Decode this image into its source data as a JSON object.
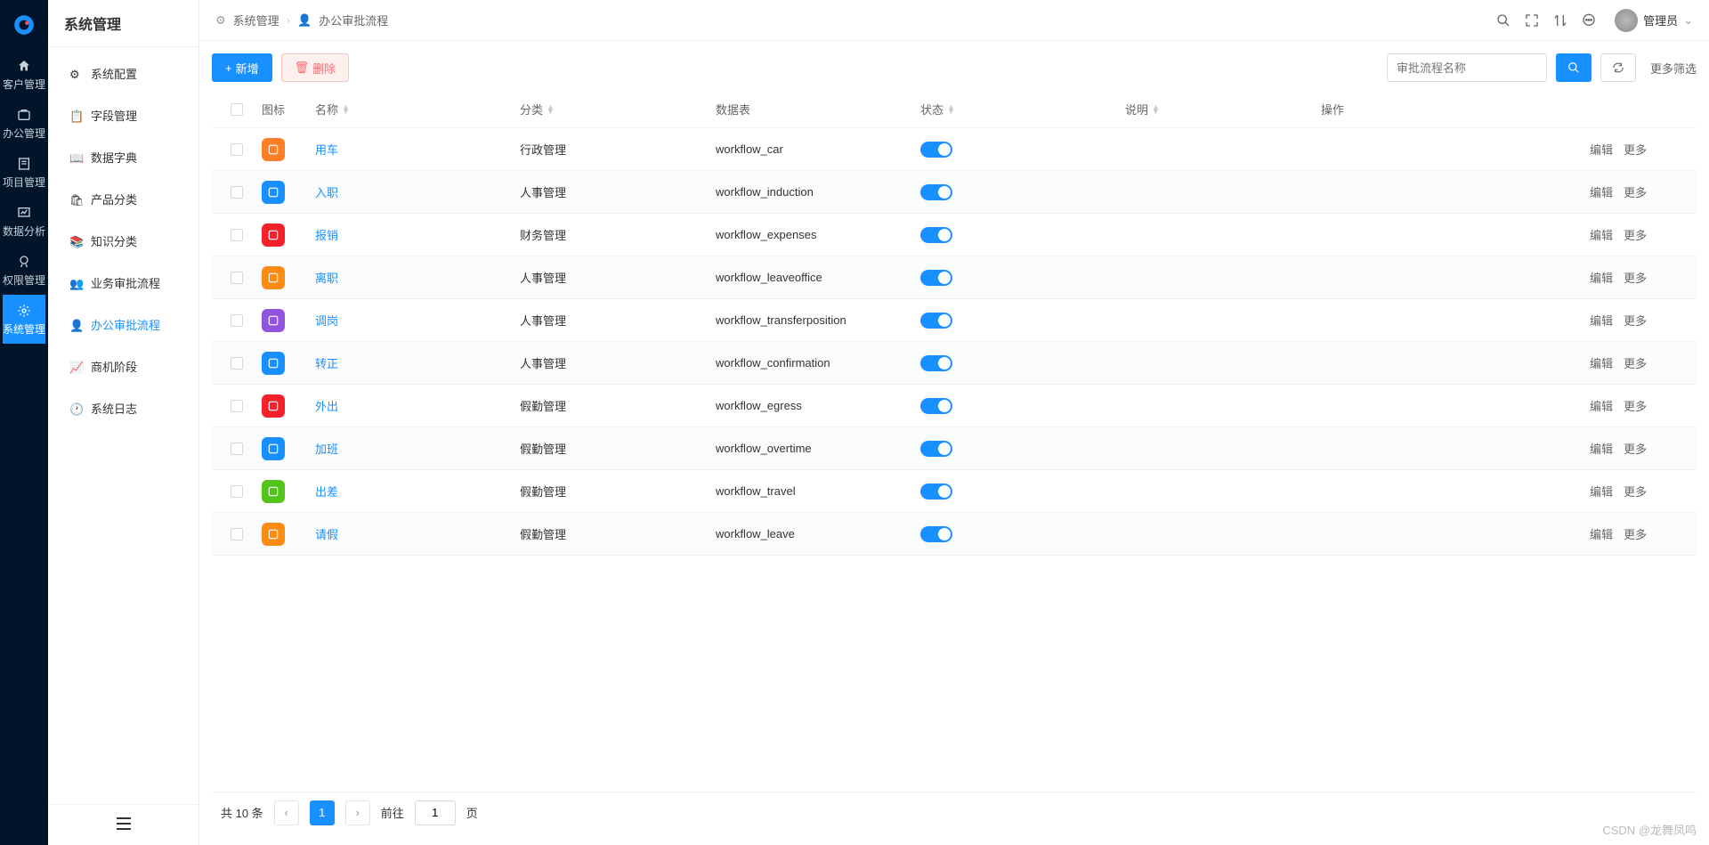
{
  "rail": {
    "items": [
      {
        "label": "客户管理"
      },
      {
        "label": "办公管理"
      },
      {
        "label": "项目管理"
      },
      {
        "label": "数据分析"
      },
      {
        "label": "权限管理"
      },
      {
        "label": "系统管理"
      }
    ]
  },
  "sidebar": {
    "title": "系统管理",
    "items": [
      {
        "label": "系统配置"
      },
      {
        "label": "字段管理"
      },
      {
        "label": "数据字典"
      },
      {
        "label": "产品分类"
      },
      {
        "label": "知识分类"
      },
      {
        "label": "业务审批流程"
      },
      {
        "label": "办公审批流程"
      },
      {
        "label": "商机阶段"
      },
      {
        "label": "系统日志"
      }
    ]
  },
  "breadcrumb": {
    "a": "系统管理",
    "b": "办公审批流程"
  },
  "user": {
    "name": "管理员"
  },
  "toolbar": {
    "add": "新增",
    "delete": "删除",
    "search_placeholder": "审批流程名称",
    "more_filter": "更多筛选"
  },
  "columns": {
    "icon": "图标",
    "name": "名称",
    "category": "分类",
    "table": "数据表",
    "status": "状态",
    "desc": "说明",
    "action": "操作"
  },
  "actions": {
    "edit": "编辑",
    "more": "更多"
  },
  "rows": [
    {
      "name": "用车",
      "category": "行政管理",
      "table": "workflow_car",
      "icon_bg": "#ff7f27"
    },
    {
      "name": "入职",
      "category": "人事管理",
      "table": "workflow_induction",
      "icon_bg": "#1890ff"
    },
    {
      "name": "报销",
      "category": "财务管理",
      "table": "workflow_expenses",
      "icon_bg": "#f5222d"
    },
    {
      "name": "离职",
      "category": "人事管理",
      "table": "workflow_leaveoffice",
      "icon_bg": "#fa8c16"
    },
    {
      "name": "调岗",
      "category": "人事管理",
      "table": "workflow_transferposition",
      "icon_bg": "#9254de"
    },
    {
      "name": "转正",
      "category": "人事管理",
      "table": "workflow_confirmation",
      "icon_bg": "#1890ff"
    },
    {
      "name": "外出",
      "category": "假勤管理",
      "table": "workflow_egress",
      "icon_bg": "#f5222d"
    },
    {
      "name": "加班",
      "category": "假勤管理",
      "table": "workflow_overtime",
      "icon_bg": "#1890ff"
    },
    {
      "name": "出差",
      "category": "假勤管理",
      "table": "workflow_travel",
      "icon_bg": "#52c41a"
    },
    {
      "name": "请假",
      "category": "假勤管理",
      "table": "workflow_leave",
      "icon_bg": "#fa8c16"
    }
  ],
  "pagination": {
    "total_text": "共 10 条",
    "page": "1",
    "goto_prefix": "前往",
    "goto_value": "1",
    "goto_suffix": "页"
  },
  "watermark": "CSDN @龙舞凤鸣"
}
